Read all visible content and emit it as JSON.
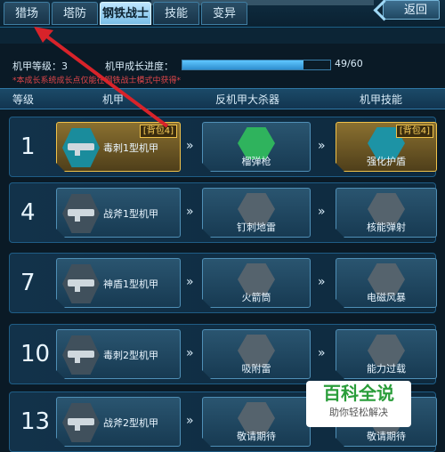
{
  "tabs": [
    {
      "label": "猎场",
      "active": false
    },
    {
      "label": "塔防",
      "active": false
    },
    {
      "label": "钢铁战士",
      "active": true
    },
    {
      "label": "技能",
      "active": false
    },
    {
      "label": "变异",
      "active": false
    }
  ],
  "back_label": "返回",
  "mech_level_label": "机甲等级：3",
  "growth_label": "机甲成长进度：",
  "progress": {
    "current": 49,
    "max": 60,
    "text": "49/60"
  },
  "notice": "*本成长系统成长点仅能在钢铁战士模式中获得*",
  "headers": {
    "level": "等级",
    "mech": "机甲",
    "weapon": "反机甲大杀器",
    "skill": "机甲技能"
  },
  "rows": [
    {
      "level": "1",
      "mech": "毒刺1型机甲",
      "mech_badge": "[背包4]",
      "weapon": "榴弹枪",
      "skill": "强化护盾",
      "skill_badge": "[背包4]",
      "unlocked": true
    },
    {
      "level": "4",
      "mech": "战斧1型机甲",
      "weapon": "钉刺地雷",
      "skill": "核能弹射",
      "unlocked": false
    },
    {
      "level": "7",
      "mech": "神盾1型机甲",
      "weapon": "火箭筒",
      "skill": "电磁风暴",
      "unlocked": false
    },
    {
      "level": "10",
      "mech": "毒刺2型机甲",
      "weapon": "吸附雷",
      "skill": "能力过载",
      "unlocked": false
    },
    {
      "level": "13",
      "mech": "战斧2型机甲",
      "weapon": "敬请期待",
      "skill": "敬请期待",
      "unlocked": false
    }
  ],
  "arrow_glyph": "»",
  "watermark": {
    "title": "百科全说",
    "subtitle": "助你轻松解决"
  },
  "colors": {
    "accent": "#5fc7ff",
    "gold": "#f0c24a",
    "annotation": "#d8232a"
  }
}
